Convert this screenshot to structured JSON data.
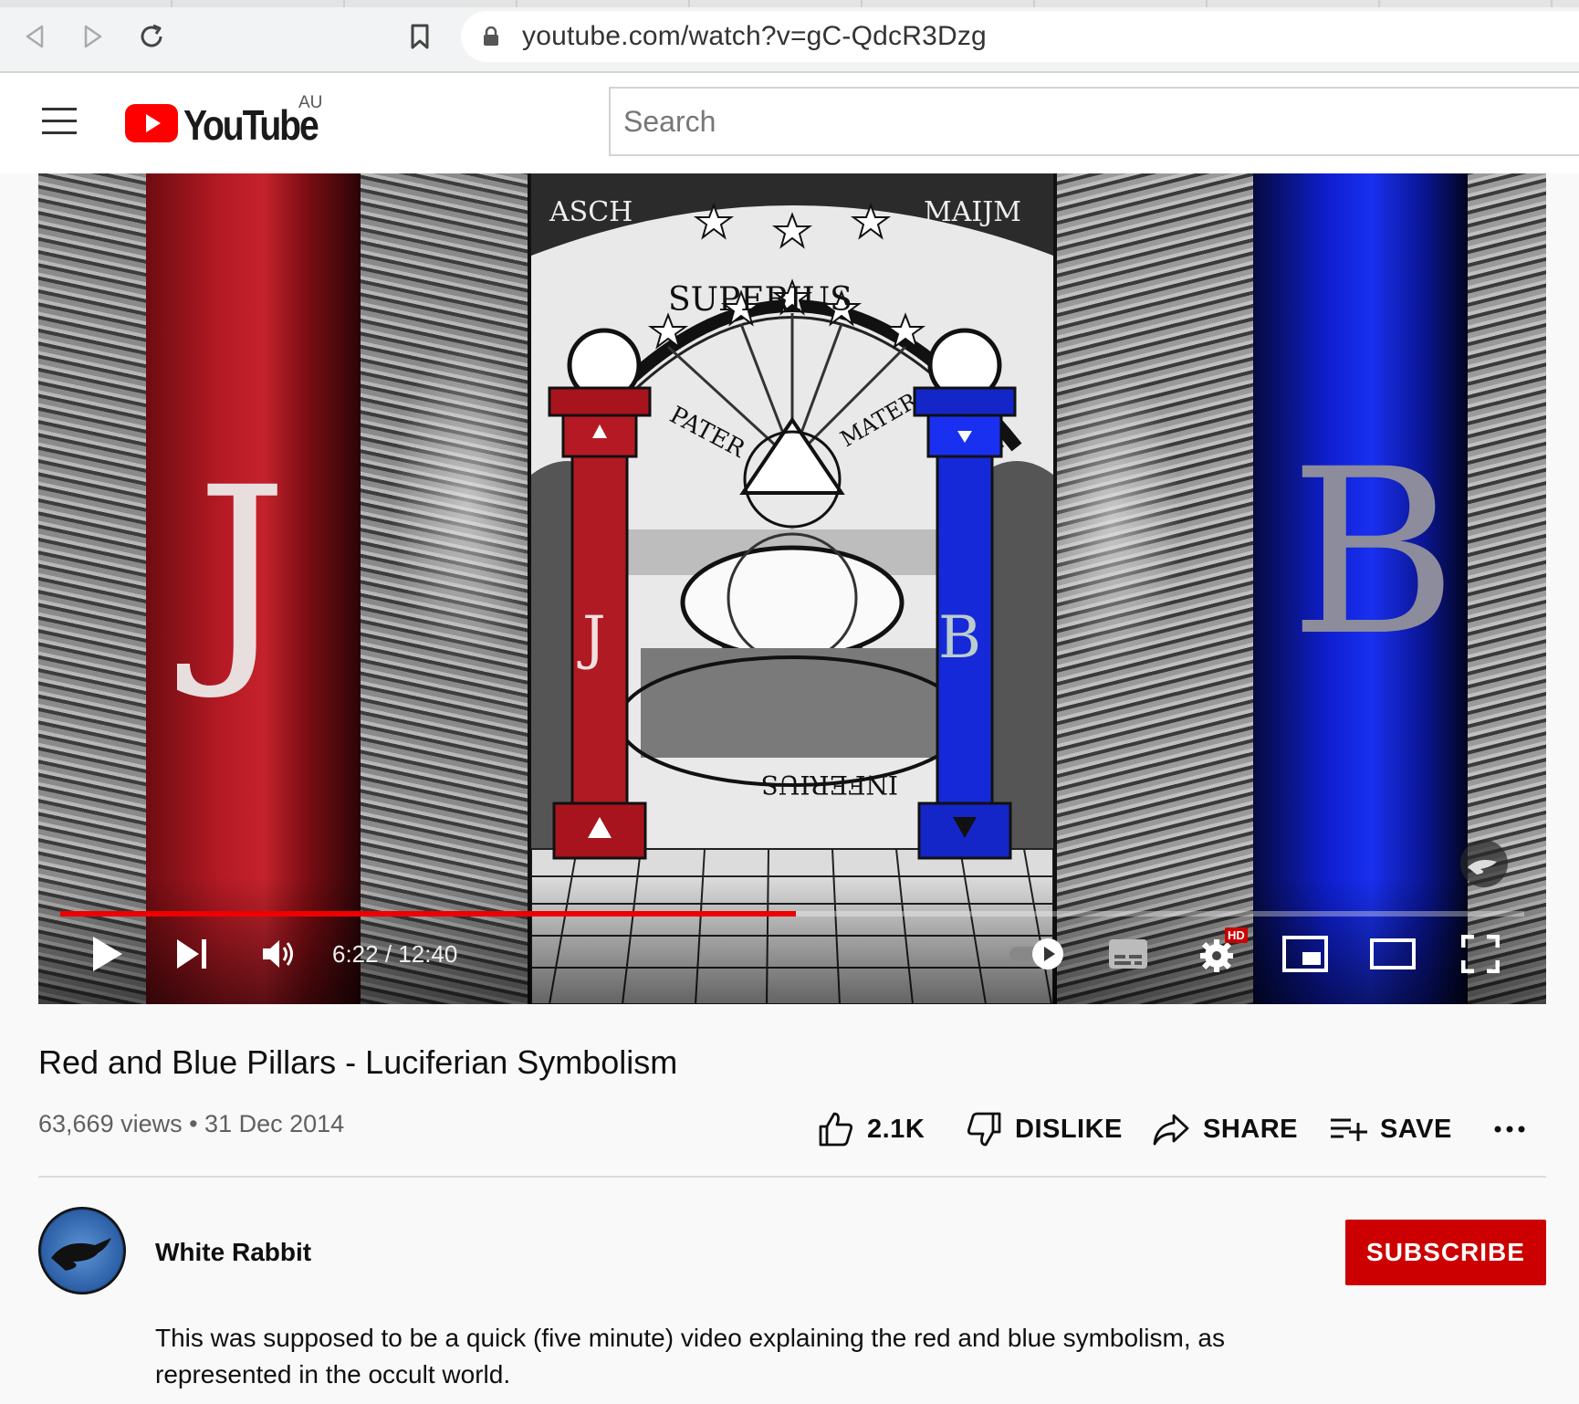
{
  "browser": {
    "url": "youtube.com/watch?v=gC-QdcR3Dzg",
    "icons": [
      "back-icon",
      "forward-icon",
      "reload-icon",
      "bookmark-icon",
      "lock-icon"
    ]
  },
  "header": {
    "logo_text": "YouTube",
    "region": "AU",
    "search_placeholder": "Search"
  },
  "player": {
    "art_left_letter": "J",
    "art_right_letter": "B",
    "art_inscriptions": {
      "top_left": "ASCH",
      "top_right": "MAIJM",
      "arc": "SUPERIUS",
      "left_ray": "PATER",
      "right_ray": "MATER",
      "base": "INFERIUS",
      "pillar_left": "J",
      "pillar_right": "B"
    },
    "time_current": "6:22",
    "time_total": "12:40",
    "time_display": "6:22 / 12:40",
    "progress_fraction": 0.5026,
    "hd_badge": "HD",
    "colors": {
      "progress": "#ee0000",
      "red_pillar": "#b51a24",
      "blue_pillar": "#1930f0"
    }
  },
  "video": {
    "title": "Red and Blue Pillars - Luciferian Symbolism",
    "meta": "63,669 views • 31 Dec 2014",
    "likes": "2.1K",
    "dislike_label": "DISLIKE",
    "share_label": "SHARE",
    "save_label": "SAVE"
  },
  "channel": {
    "name": "White Rabbit",
    "subscribe_label": "SUBSCRIBE",
    "description": "This was supposed to be a quick (five minute) video explaining the red and blue symbolism, as represented in the occult world."
  }
}
